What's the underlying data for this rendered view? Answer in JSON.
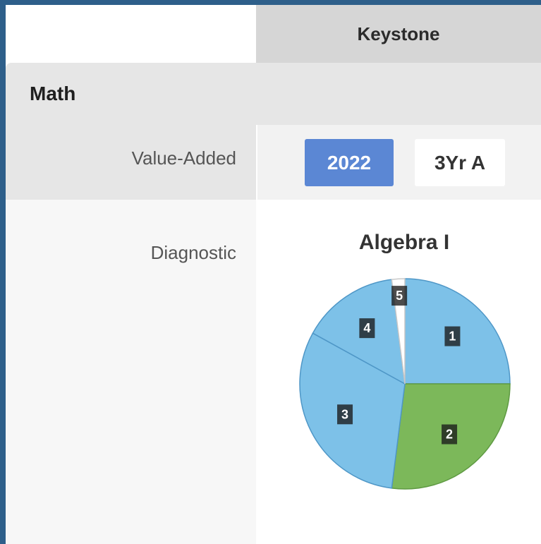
{
  "header": {
    "column_title": "Keystone"
  },
  "subject": {
    "title": "Math"
  },
  "value_added": {
    "label": "Value-Added",
    "options": [
      {
        "label": "2022",
        "selected": true
      },
      {
        "label": "3Yr A",
        "selected": false
      }
    ]
  },
  "diagnostic": {
    "label": "Diagnostic"
  },
  "colors": {
    "active_pill": "#5b87d4",
    "blue_slice": "#7dc1e8",
    "green_slice": "#7cb85a",
    "white_slice": "#ffffff"
  },
  "chart_data": {
    "type": "pie",
    "title": "Algebra I",
    "slices": [
      {
        "label": "1",
        "value": 25.0,
        "color": "#7dc1e8"
      },
      {
        "label": "2",
        "value": 27.0,
        "color": "#7cb85a"
      },
      {
        "label": "3",
        "value": 31.0,
        "color": "#7dc1e8"
      },
      {
        "label": "4",
        "value": 15.0,
        "color": "#7dc1e8"
      },
      {
        "label": "5",
        "value": 2.0,
        "color": "#ffffff"
      }
    ]
  }
}
